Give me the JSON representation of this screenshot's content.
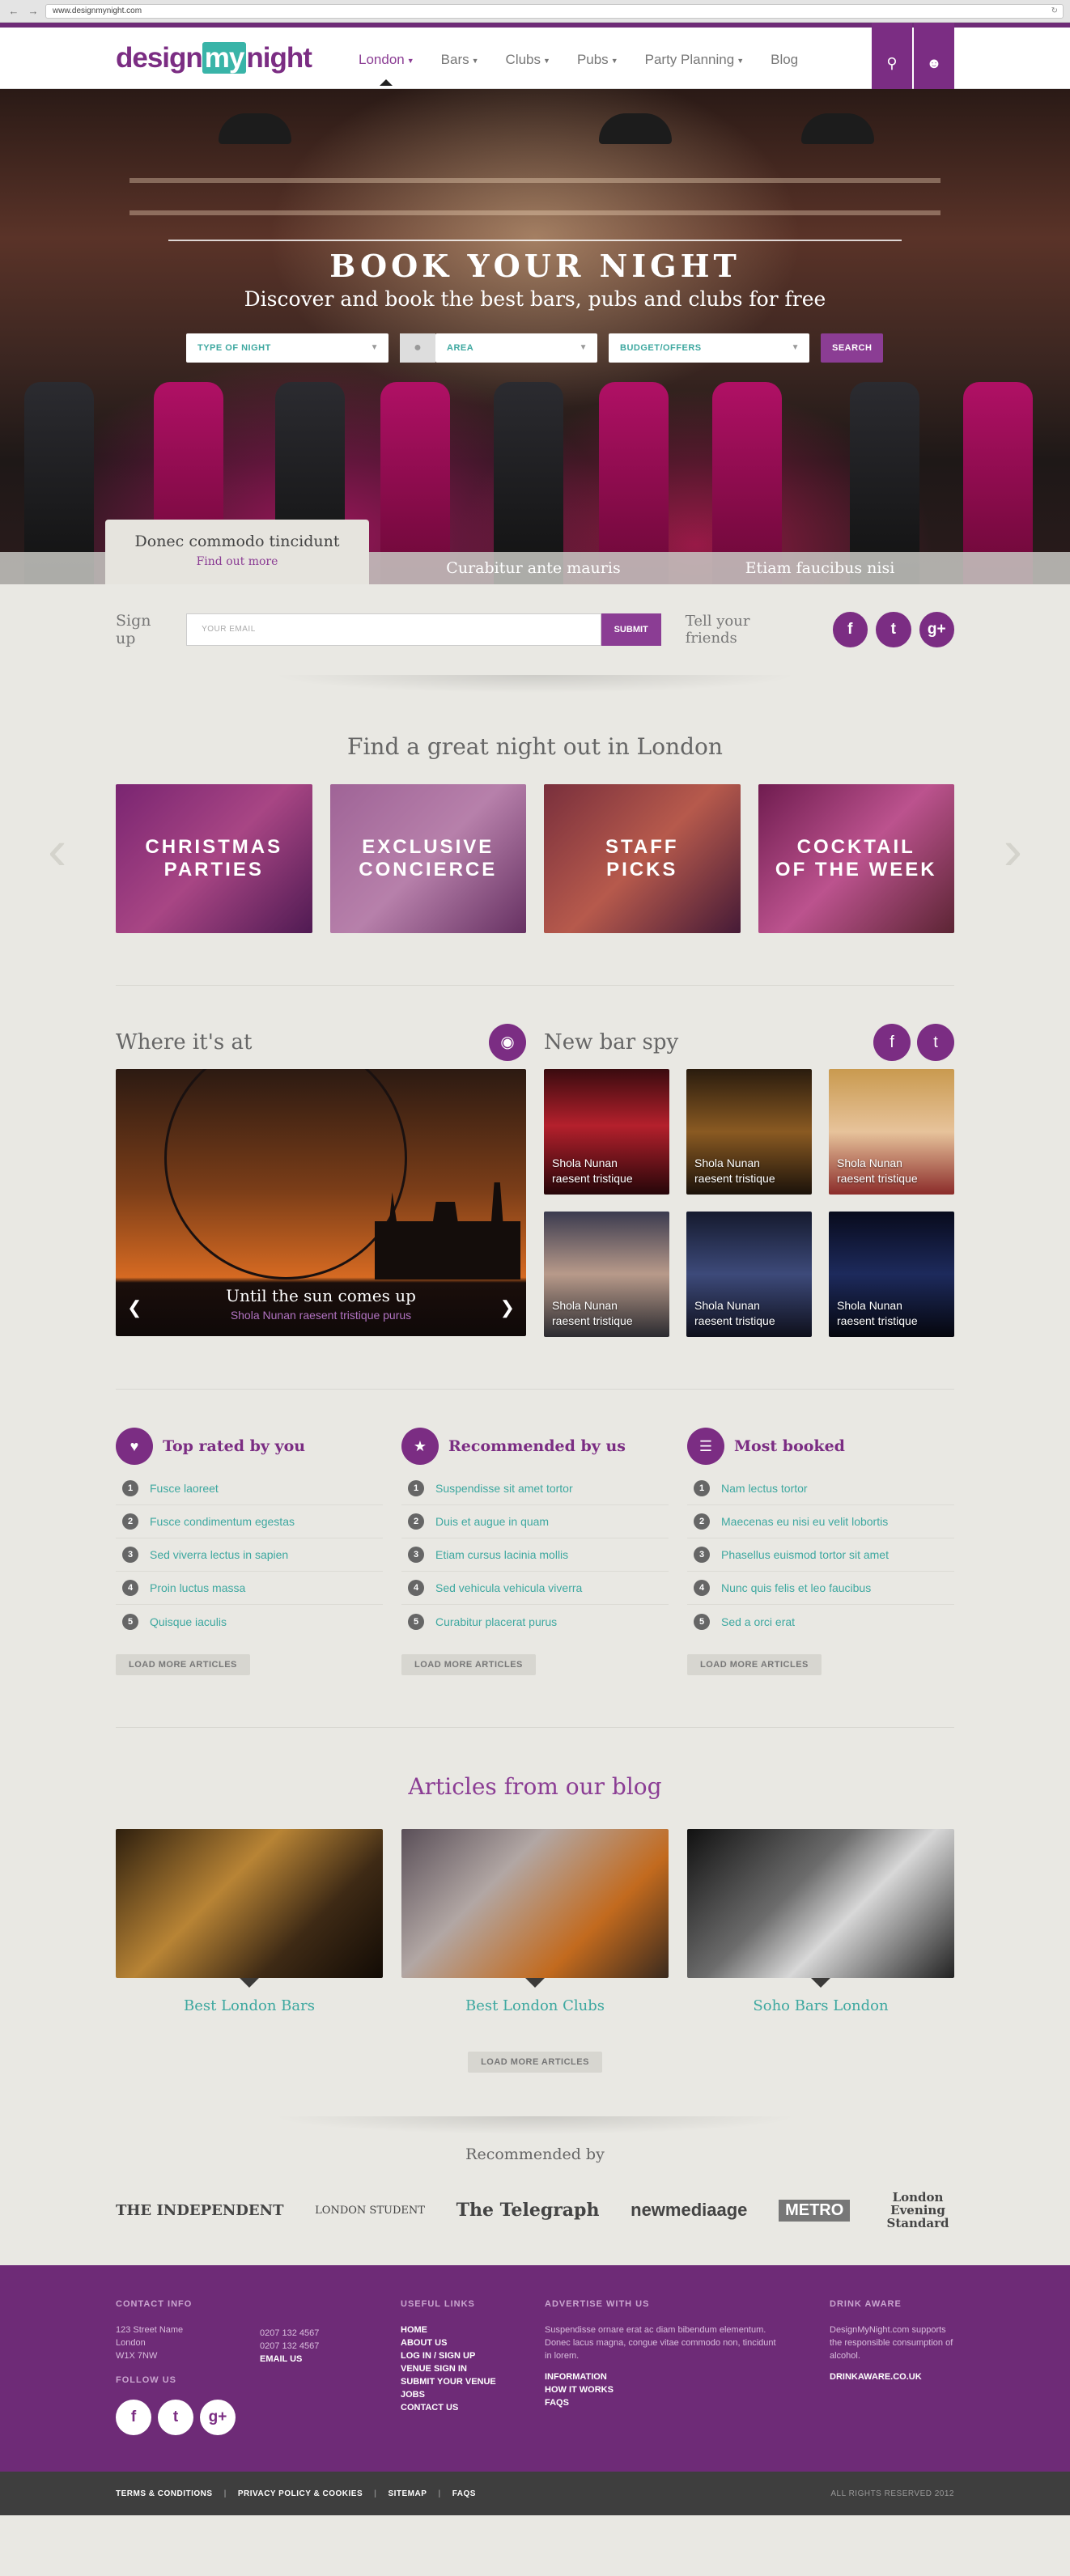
{
  "browser": {
    "url": "www.designmynight.com"
  },
  "header": {
    "logo": {
      "pre": "design",
      "mid": "my",
      "post": "night"
    },
    "nav": [
      {
        "label": "London",
        "active": true
      },
      {
        "label": "Bars"
      },
      {
        "label": "Clubs"
      },
      {
        "label": "Pubs"
      },
      {
        "label": "Party Planning"
      },
      {
        "label": "Blog",
        "nocaret": true
      }
    ],
    "search_icon": "search-icon",
    "user_icon": "user-icon"
  },
  "hero": {
    "title": "BOOK YOUR NIGHT",
    "subtitle": "Discover and book the best bars, pubs and clubs for free",
    "type_placeholder": "TYPE OF NIGHT",
    "area_placeholder": "AREA",
    "budget_placeholder": "BUDGET/OFFERS",
    "search_label": "SEARCH",
    "tabs": [
      {
        "label": "Donec commodo tincidunt",
        "sub": "Find out more"
      },
      {
        "label": "Curabitur ante mauris"
      },
      {
        "label": "Etiam faucibus nisi"
      }
    ]
  },
  "signup": {
    "label": "Sign up",
    "email_placeholder": "YOUR EMAIL",
    "submit": "SUBMIT",
    "tell": "Tell your friends",
    "social": [
      "f",
      "t",
      "g+"
    ]
  },
  "find": {
    "title": "Find a great night out in London",
    "tiles": [
      "CHRISTMAS\nPARTIES",
      "EXCLUSIVE\nCONCIERCE",
      "STAFF\nPICKS",
      "COCKTAIL\nOF THE WEEK"
    ]
  },
  "where": {
    "title": "Where it's at",
    "caption": "Until the sun comes up",
    "sub": "Shola Nunan raesent tristique purus"
  },
  "spy": {
    "title": "New bar spy",
    "items": [
      {
        "line1": "Shola Nunan",
        "line2": "raesent tristique"
      },
      {
        "line1": "Shola Nunan",
        "line2": "raesent tristique"
      },
      {
        "line1": "Shola Nunan",
        "line2": "raesent tristique"
      },
      {
        "line1": "Shola Nunan",
        "line2": "raesent tristique"
      },
      {
        "line1": "Shola Nunan",
        "line2": "raesent tristique"
      },
      {
        "line1": "Shola Nunan",
        "line2": "raesent tristique"
      }
    ]
  },
  "lists": [
    {
      "title": "Top rated by you",
      "icon": "heart-icon",
      "items": [
        "Fusce laoreet",
        "Fusce condimentum egestas",
        "Sed viverra lectus in sapien",
        "Proin luctus massa",
        "Quisque iaculis"
      ]
    },
    {
      "title": "Recommended by us",
      "icon": "star-icon",
      "items": [
        "Suspendisse sit amet tortor",
        "Duis et augue in quam",
        "Etiam cursus lacinia mollis",
        "Sed vehicula vehicula viverra",
        "Curabitur placerat purus"
      ]
    },
    {
      "title": "Most booked",
      "icon": "clipboard-icon",
      "items": [
        "Nam lectus tortor",
        "Maecenas eu nisi eu velit lobortis",
        "Phasellus euismod tortor sit amet",
        "Nunc quis felis et leo faucibus",
        "Sed a orci erat"
      ]
    }
  ],
  "load_more": "LOAD MORE ARTICLES",
  "blog": {
    "title": "Articles from our blog",
    "posts": [
      "Best London Bars",
      "Best London Clubs",
      "Soho Bars London"
    ]
  },
  "recommended": {
    "title": "Recommended by",
    "press": [
      "THE INDEPENDENT",
      "LONDON STUDENT",
      "The Telegraph",
      "newmediaage",
      "METRO",
      "London Evening Standard"
    ]
  },
  "footer": {
    "contact": {
      "heading": "CONTACT INFO",
      "address": [
        "123 Street Name",
        "London",
        "W1X 7NW"
      ],
      "phones": [
        "0207 132 4567",
        "0207 132 4567"
      ],
      "email": "EMAIL US"
    },
    "follow": {
      "heading": "FOLLOW US",
      "social": [
        "f",
        "t",
        "g+"
      ]
    },
    "useful": {
      "heading": "USEFUL LINKS",
      "links": [
        "HOME",
        "ABOUT US",
        "LOG IN / SIGN UP",
        "VENUE SIGN IN",
        "SUBMIT YOUR VENUE",
        "JOBS",
        "CONTACT US"
      ]
    },
    "advertise": {
      "heading": "ADVERTISE WITH US",
      "text": "Suspendisse ornare erat ac diam bibendum elementum. Donec lacus magna, congue vitae commodo non, tincidunt in lorem.",
      "links": [
        "INFORMATION",
        "HOW IT WORKS",
        "FAQS"
      ]
    },
    "drink": {
      "heading": "DRINK AWARE",
      "text": "DesignMyNight.com supports the responsible consumption of alcohol.",
      "link": "DRINKAWARE.CO.UK"
    },
    "bottom_links": [
      "TERMS & CONDITIONS",
      "PRIVACY POLICY & COOKIES",
      "SITEMAP",
      "FAQS"
    ],
    "rights": "ALL RIGHTS RESERVED 2012"
  }
}
